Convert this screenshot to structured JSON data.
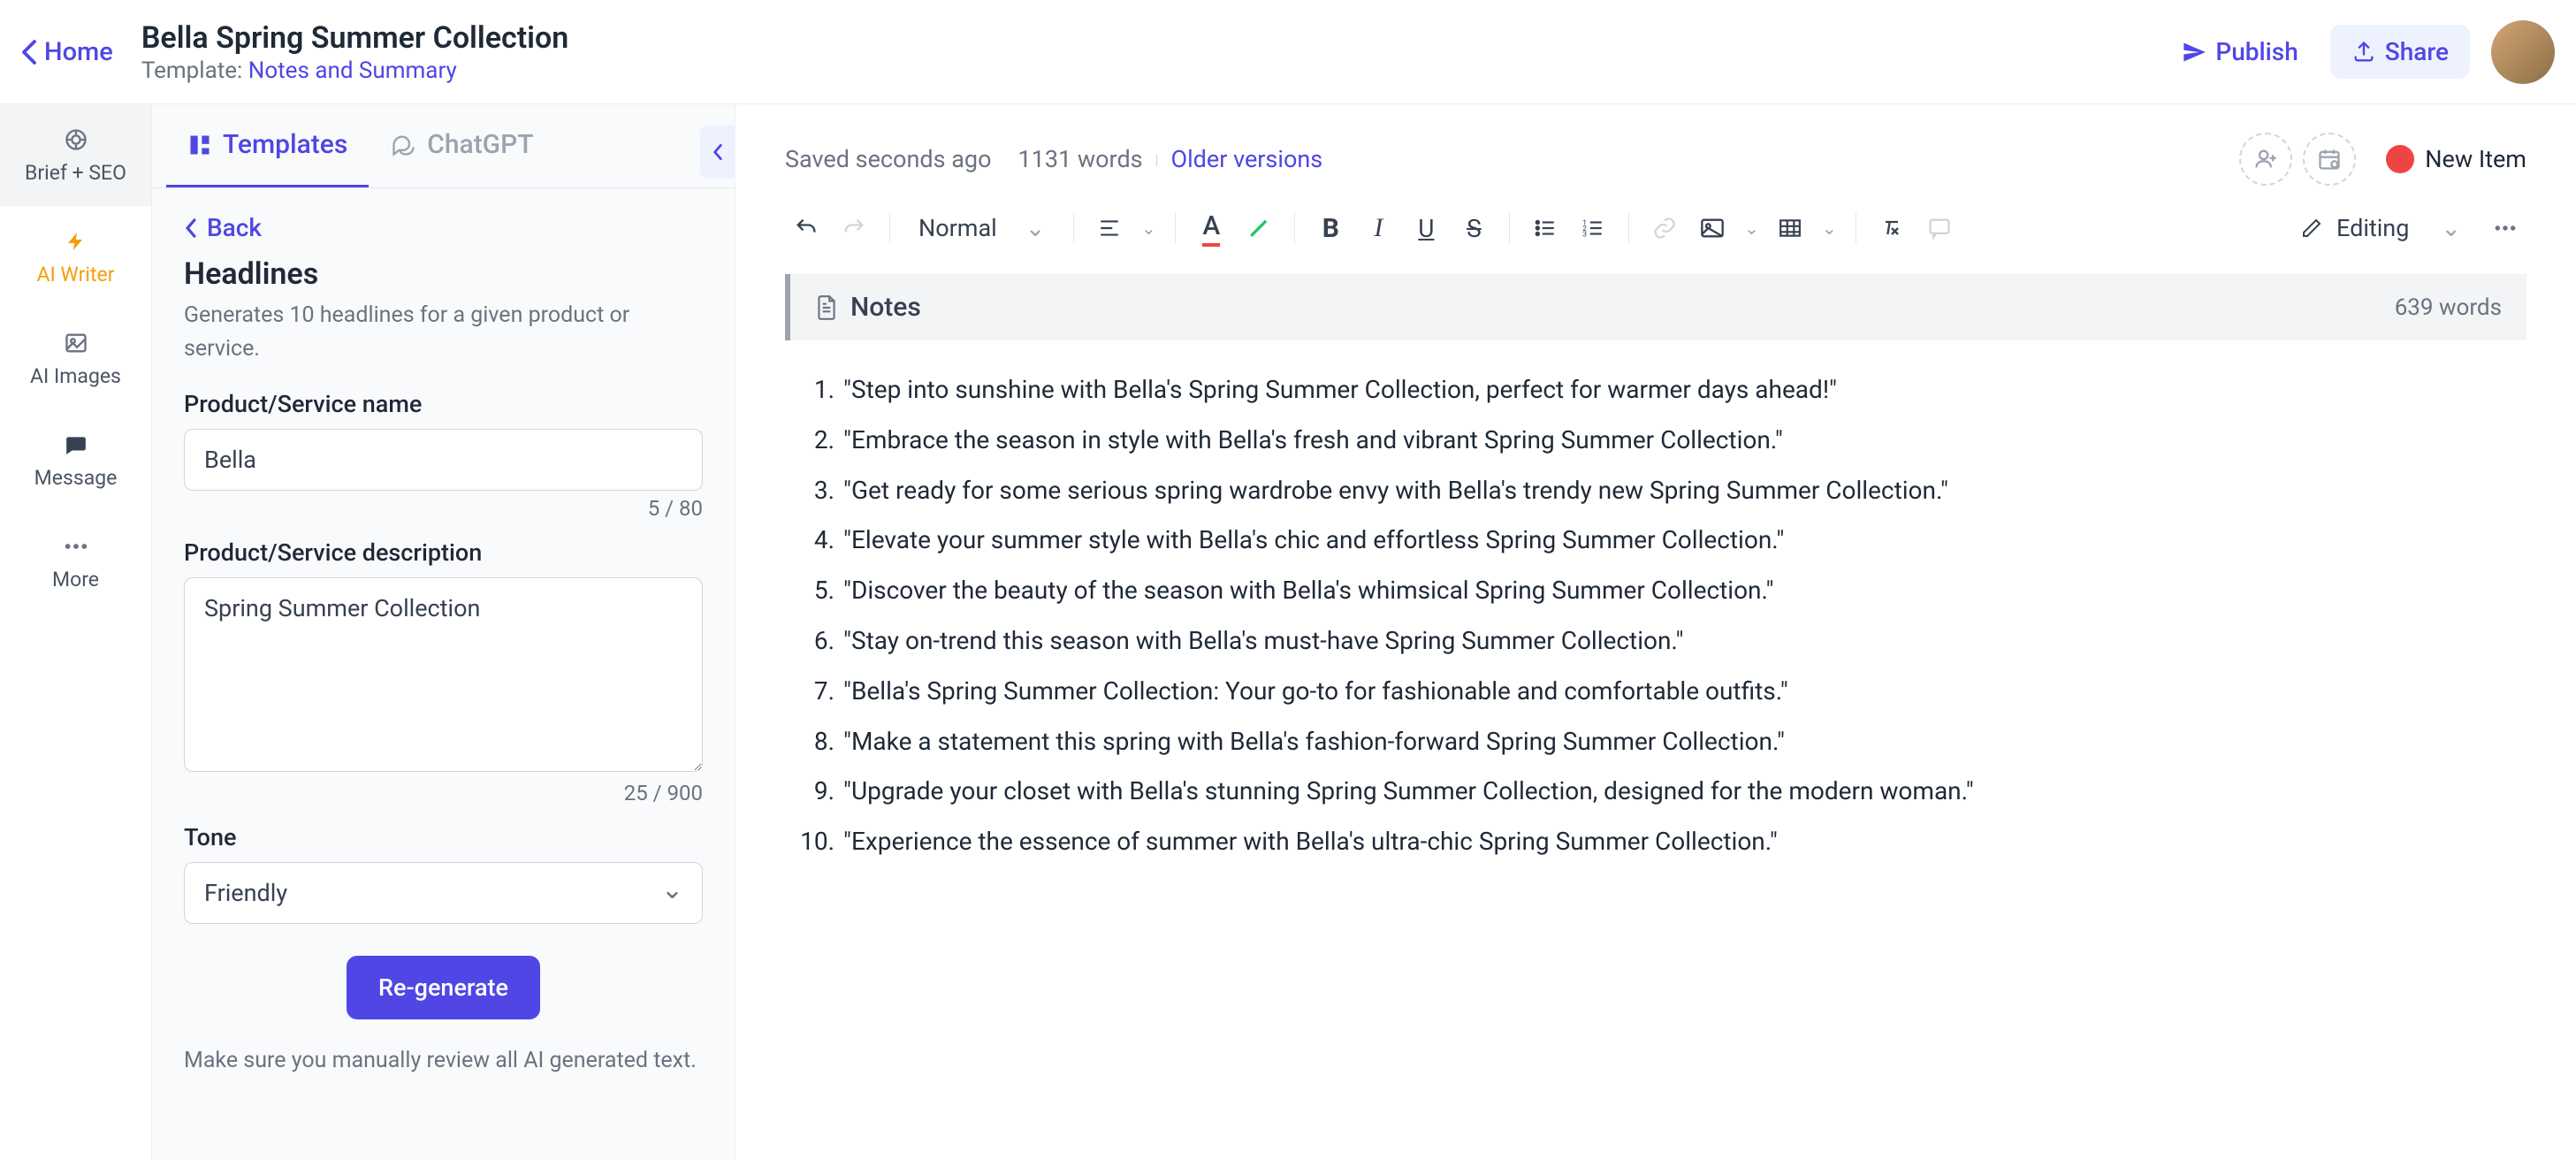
{
  "header": {
    "home": "Home",
    "title": "Bella Spring Summer Collection",
    "template_prefix": "Template: ",
    "template_name": "Notes and Summary",
    "publish": "Publish",
    "share": "Share"
  },
  "vnav": {
    "brief": "Brief + SEO",
    "writer": "AI Writer",
    "images": "AI Images",
    "message": "Message",
    "more": "More"
  },
  "tabs": {
    "templates": "Templates",
    "chatgpt": "ChatGPT"
  },
  "panel": {
    "back": "Back",
    "title": "Headlines",
    "desc": "Generates 10 headlines for a given product or service.",
    "name_label": "Product/Service name",
    "name_value": "Bella",
    "name_counter": "5 / 80",
    "desc_label": "Product/Service description",
    "desc_value": "Spring Summer Collection",
    "desc_counter": "25 / 900",
    "tone_label": "Tone",
    "tone_value": "Friendly",
    "regenerate": "Re-generate",
    "warn": "Make sure you manually review all AI generated text."
  },
  "editor": {
    "saved": "Saved seconds ago",
    "words_top": "1131 words",
    "older": "Older versions",
    "new_item": "New Item",
    "style_select": "Normal",
    "editing_select": "Editing",
    "notes_label": "Notes",
    "notes_words": "639 words",
    "list": [
      "\"Step into sunshine with Bella's Spring Summer Collection, perfect for warmer days ahead!\"",
      "\"Embrace the season in style with Bella's fresh and vibrant Spring Summer Collection.\"",
      "\"Get ready for some serious spring wardrobe envy with Bella's trendy new Spring Summer Collection.\"",
      "\"Elevate your summer style with Bella's chic and effortless Spring Summer Collection.\"",
      "\"Discover the beauty of the season with Bella's whimsical Spring Summer Collection.\"",
      "\"Stay on-trend this season with Bella's must-have Spring Summer Collection.\"",
      "\"Bella's Spring Summer Collection: Your go-to for fashionable and comfortable outfits.\"",
      "\"Make a statement this spring with Bella's fashion-forward Spring Summer Collection.\"",
      "\"Upgrade your closet with Bella's stunning Spring Summer Collection, designed for the modern woman.\"",
      "\"Experience the essence of summer with Bella's ultra-chic Spring Summer Collection.\""
    ]
  }
}
